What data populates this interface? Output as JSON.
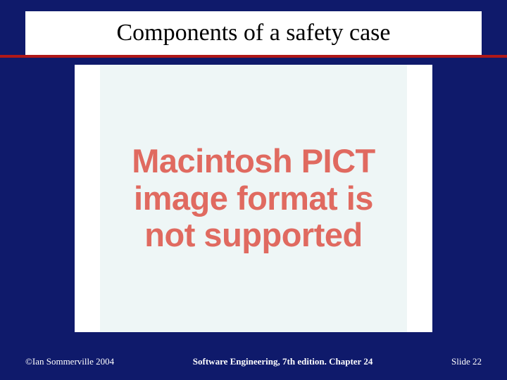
{
  "slide": {
    "title": "Components of a safety case",
    "placeholder": "Macintosh PICT image format is not supported"
  },
  "footer": {
    "copyright": "©Ian Sommerville 2004",
    "center": "Software Engineering, 7th edition. Chapter 24",
    "slide_label": "Slide 22"
  },
  "colors": {
    "background": "#0f1a6b",
    "rule": "#b01818",
    "placeholder_text": "#e06a60",
    "content_bg": "#eef6f6"
  }
}
